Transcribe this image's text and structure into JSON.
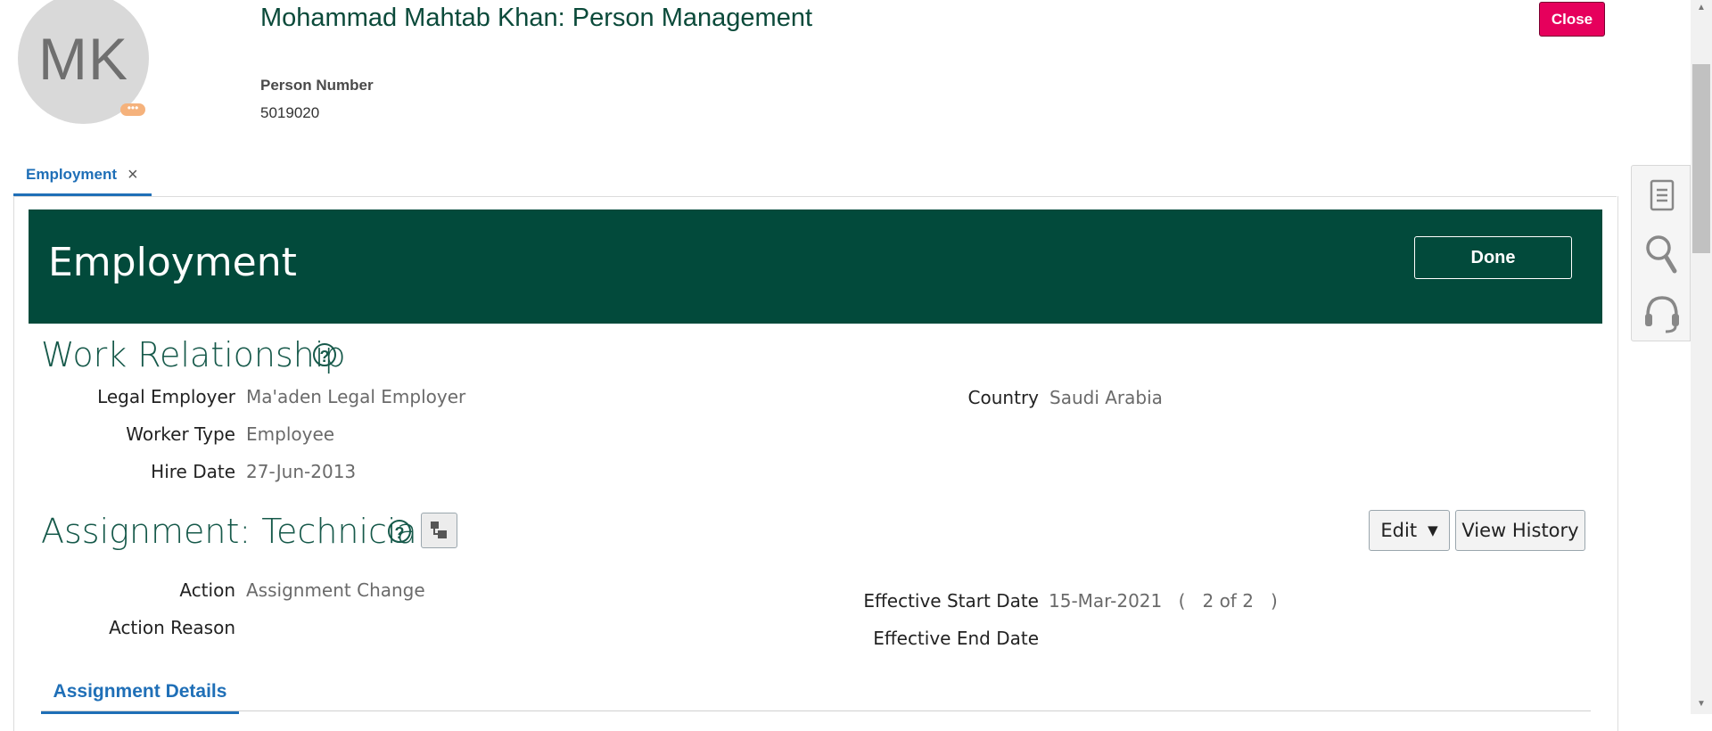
{
  "header": {
    "avatar_initials": "MK",
    "avatar_badge": "•••",
    "title": "Mohammad Mahtab Khan: Person Management",
    "person_number_label": "Person Number",
    "person_number_value": "5019020",
    "close_label": "Close"
  },
  "tabs": [
    {
      "label": "Employment",
      "close_glyph": "×"
    }
  ],
  "banner": {
    "title": "Employment",
    "done_label": "Done"
  },
  "work_relationship": {
    "title": "Work Relationship",
    "fields": {
      "legal_employer": {
        "label": "Legal Employer",
        "value": "Ma'aden Legal Employer"
      },
      "worker_type": {
        "label": "Worker Type",
        "value": "Employee"
      },
      "hire_date": {
        "label": "Hire Date",
        "value": "27-Jun-2013"
      },
      "country": {
        "label": "Country",
        "value": "Saudi Arabia"
      }
    }
  },
  "assignment": {
    "title": "Assignment: Technician",
    "edit_label": "Edit",
    "view_history_label": "View History",
    "fields": {
      "action": {
        "label": "Action",
        "value": "Assignment Change"
      },
      "action_reason": {
        "label": "Action Reason",
        "value": ""
      },
      "effective_start": {
        "label": "Effective Start Date",
        "value": "15-Mar-2021",
        "record_info": "(   2 of 2   )"
      },
      "effective_end": {
        "label": "Effective End Date",
        "value": ""
      }
    }
  },
  "sub_tabs": [
    {
      "label": "Assignment Details"
    }
  ],
  "side_panel": {
    "icons": [
      "document-icon",
      "search-icon",
      "headset-icon"
    ]
  },
  "colors": {
    "brand_green": "#024a3b",
    "title_green": "#16594a",
    "link_blue": "#1f6fb7",
    "close_red": "#e6005c"
  }
}
